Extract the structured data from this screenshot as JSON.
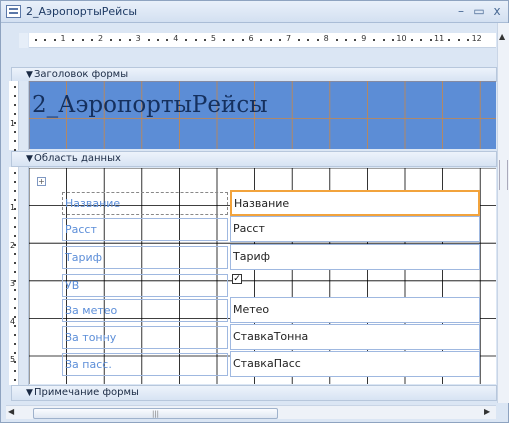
{
  "window": {
    "title": "2_АэропортыРейсы",
    "minimize": "–",
    "maximize": "▭",
    "close": "x"
  },
  "ruler": {
    "ticks": [
      "1",
      "2",
      "3",
      "4",
      "5",
      "6",
      "7",
      "8",
      "9",
      "10",
      "11",
      "12"
    ]
  },
  "vruler": {
    "header_ticks": [
      "1"
    ],
    "detail_ticks": [
      "1",
      "2",
      "3",
      "4",
      "5"
    ]
  },
  "sections": {
    "header": "Заголовок формы",
    "detail": "Область данных",
    "footer": "Примечание формы"
  },
  "header": {
    "title": "2_АэропортыРейсы"
  },
  "fields": [
    {
      "label": "Название",
      "field": "Название",
      "type": "text",
      "selected": true
    },
    {
      "label": "Расст",
      "field": "Расст",
      "type": "text",
      "selected": false
    },
    {
      "label": "Тариф",
      "field": "Тариф",
      "type": "text",
      "selected": false
    },
    {
      "label": "УВ",
      "field": "",
      "type": "checkbox",
      "selected": false
    },
    {
      "label": "За метео",
      "field": "Метео",
      "type": "text",
      "selected": false
    },
    {
      "label": "За тонну",
      "field": "СтавкаТонна",
      "type": "text",
      "selected": false
    },
    {
      "label": "За пасс.",
      "field": "СтавкаПасс",
      "type": "text",
      "selected": false
    }
  ],
  "colors": {
    "accent": "#5c8dd6",
    "label_text": "#5c8ed8",
    "selection": "#f2a33c",
    "grid": "#c7874a"
  }
}
